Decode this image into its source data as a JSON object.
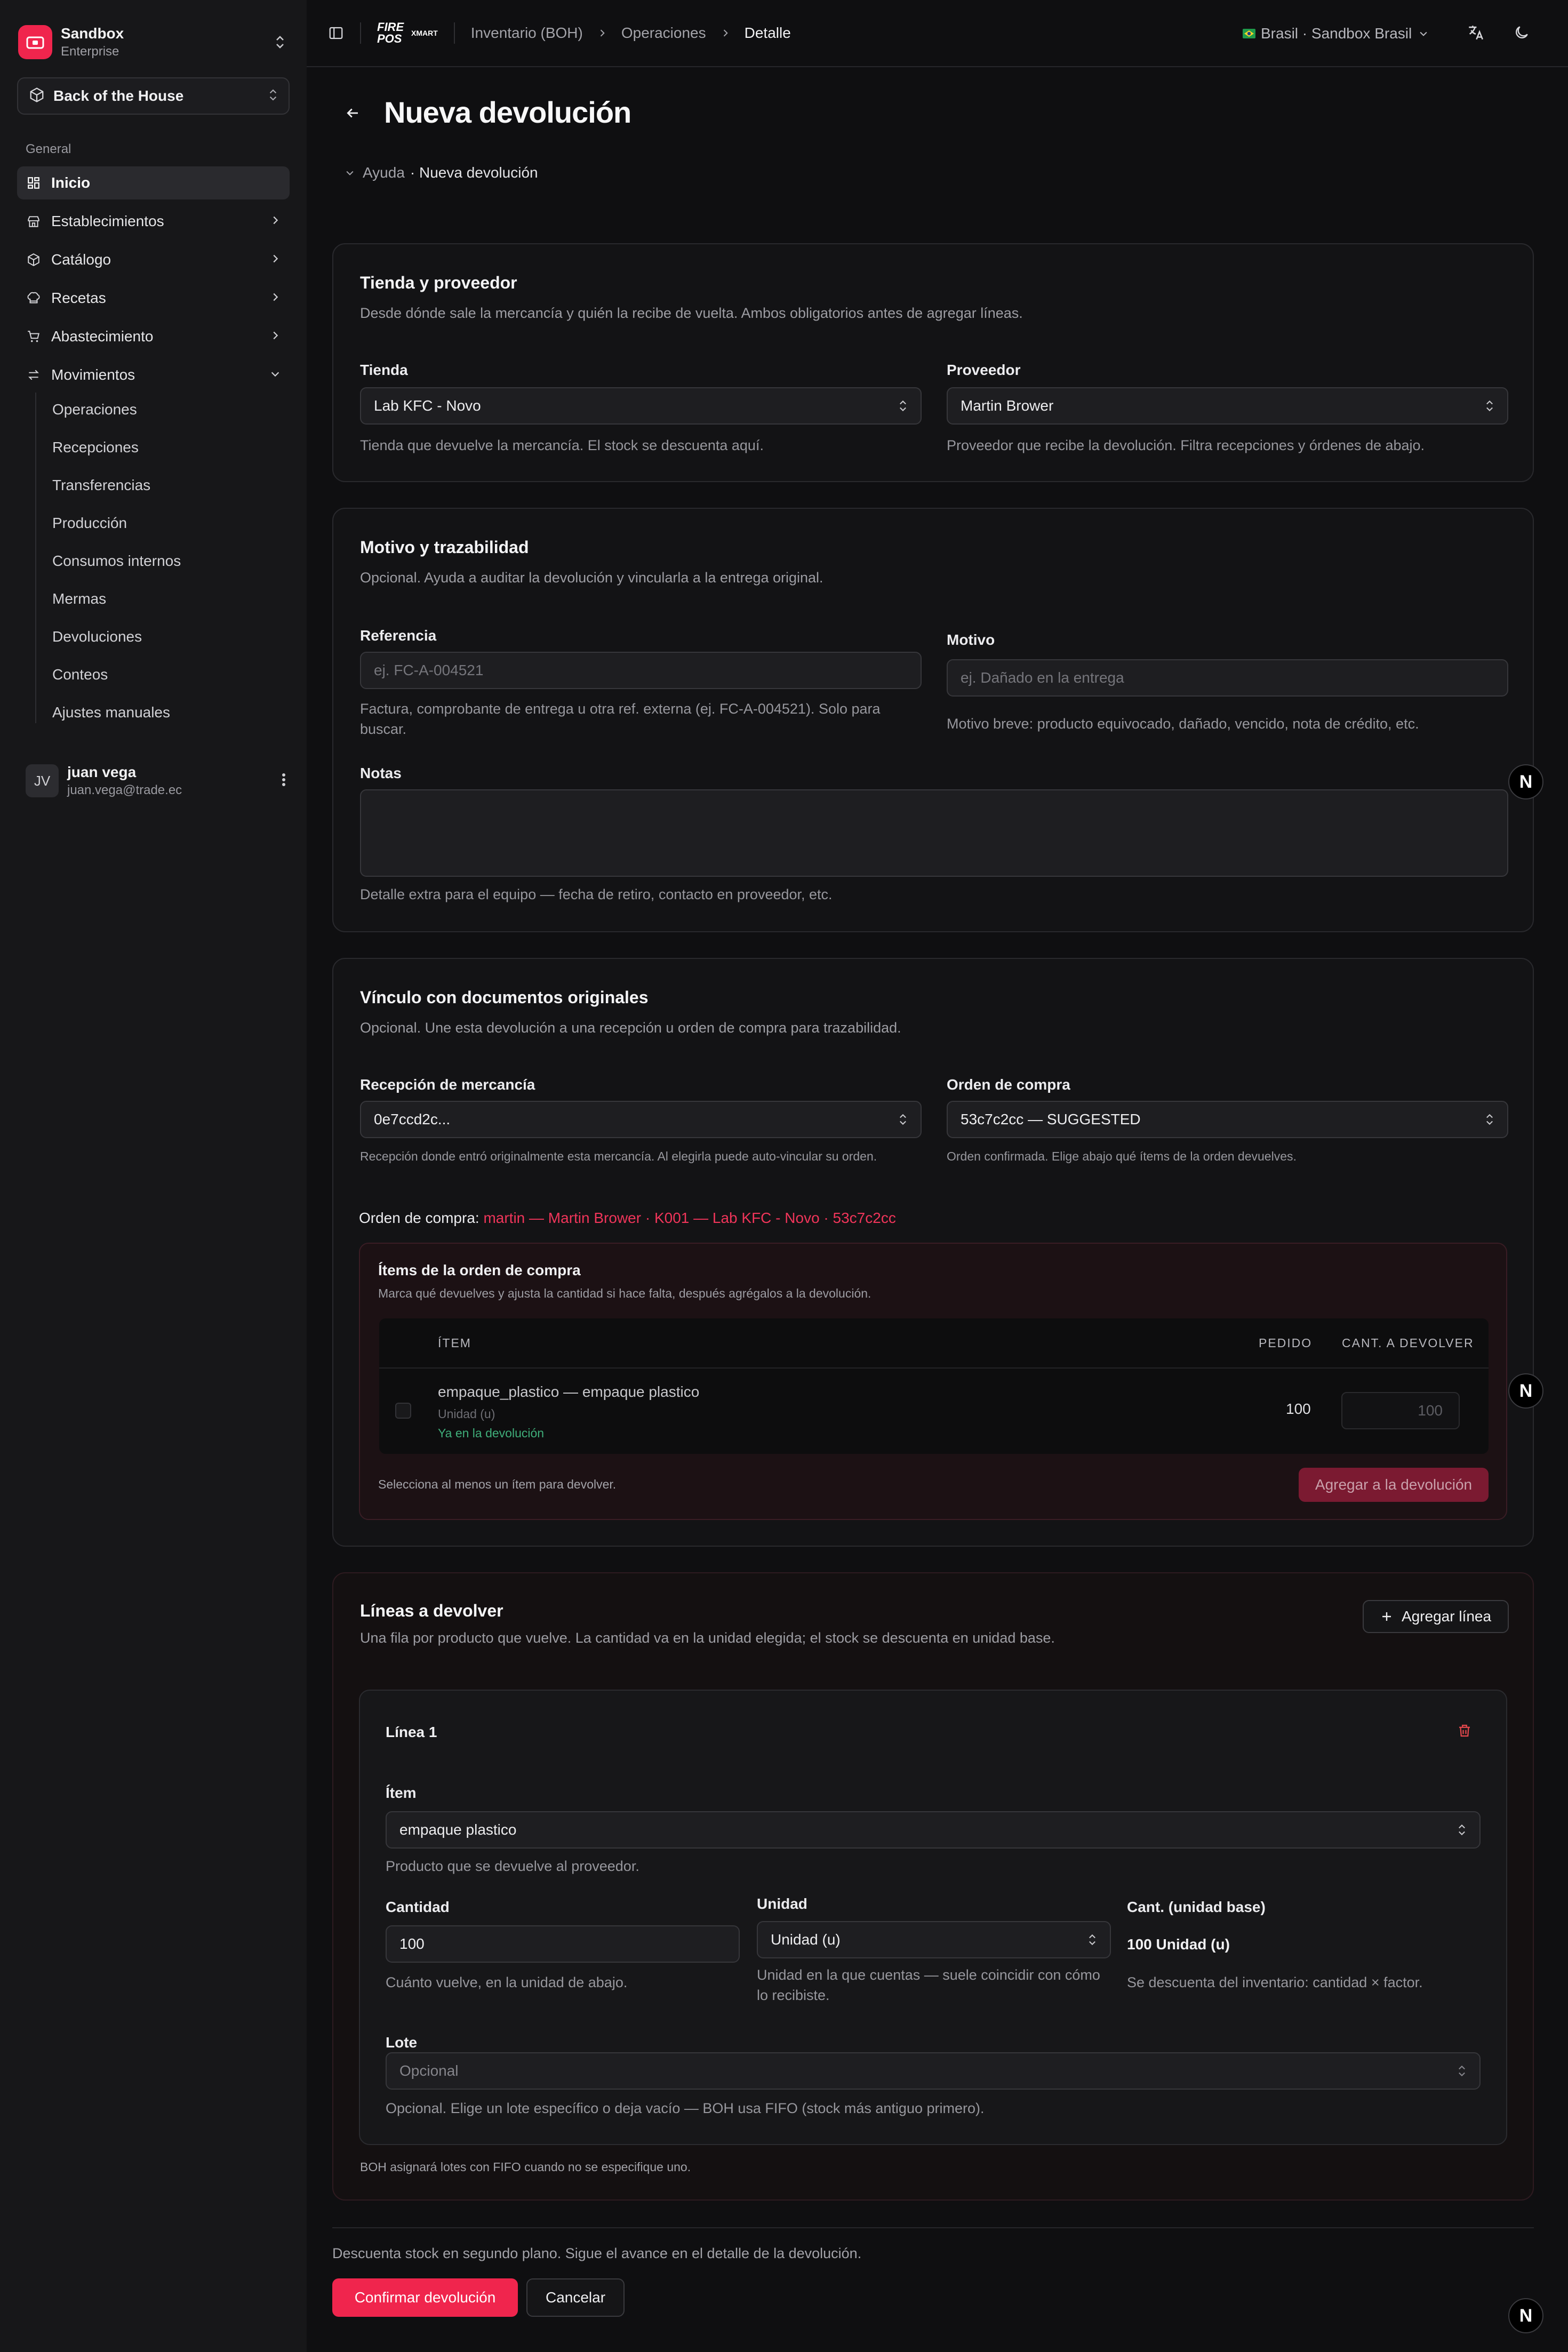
{
  "colors": {
    "accent": "#f0254d",
    "pink_text": "#f0355a",
    "green": "#3fae7a",
    "background": "#0f0f11",
    "sidebar": "#171719"
  },
  "sidebar": {
    "org_name": "Sandbox",
    "org_plan": "Enterprise",
    "module": "Back of the House",
    "section_label": "General",
    "items": [
      {
        "label": "Inicio",
        "icon": "dashboard-icon"
      },
      {
        "label": "Establecimientos",
        "icon": "store-icon"
      },
      {
        "label": "Catálogo",
        "icon": "package-icon"
      },
      {
        "label": "Recetas",
        "icon": "chef-hat-icon"
      },
      {
        "label": "Abastecimiento",
        "icon": "cart-icon"
      },
      {
        "label": "Movimientos",
        "icon": "arrows-swap-icon"
      }
    ],
    "sub_items": [
      "Operaciones",
      "Recepciones",
      "Transferencias",
      "Producción",
      "Consumos internos",
      "Mermas",
      "Devoluciones",
      "Conteos",
      "Ajustes manuales"
    ],
    "user": {
      "initials": "JV",
      "name": "juan vega",
      "email": "juan.vega@trade.ec"
    }
  },
  "topbar": {
    "logo_text": "FIRE POS",
    "logo_sub": "XMART",
    "breadcrumb": [
      "Inventario (BOH)",
      "Operaciones",
      "Detalle"
    ],
    "region": "Brasil · Sandbox Brasil"
  },
  "page": {
    "title": "Nueva devolución",
    "help_toggle": "Ayuda",
    "help_title": "· Nueva devolución"
  },
  "store_supplier": {
    "title": "Tienda y proveedor",
    "desc": "Desde dónde sale la mercancía y quién la recibe de vuelta. Ambos obligatorios antes de agregar líneas.",
    "store_label": "Tienda",
    "store_value": "Lab KFC - Novo",
    "store_help": "Tienda que devuelve la mercancía. El stock se descuenta aquí.",
    "supplier_label": "Proveedor",
    "supplier_value": "Martin Brower",
    "supplier_help": "Proveedor que recibe la devolución. Filtra recepciones y órdenes de abajo."
  },
  "reason": {
    "title": "Motivo y trazabilidad",
    "desc": "Opcional. Ayuda a auditar la devolución y vincularla a la entrega original.",
    "ref_label": "Referencia",
    "ref_placeholder": "ej. FC-A-004521",
    "ref_help": "Factura, comprobante de entrega u otra ref. externa (ej. FC-A-004521). Solo para buscar.",
    "reason_label": "Motivo",
    "reason_placeholder": "ej. Dañado en la entrega",
    "reason_help": "Motivo breve: producto equivocado, dañado, vencido, nota de crédito, etc.",
    "notes_label": "Notas",
    "notes_help": "Detalle extra para el equipo — fecha de retiro, contacto en proveedor, etc."
  },
  "link": {
    "title": "Vínculo con documentos originales",
    "desc": "Opcional. Une esta devolución a una recepción u orden de compra para trazabilidad.",
    "reception_label": "Recepción de mercancía",
    "reception_value": "0e7ccd2c...",
    "reception_help": "Recepción donde entró originalmente esta mercancía. Al elegirla puede auto-vincular su orden.",
    "po_label": "Orden de compra",
    "po_value": "53c7c2cc — SUGGESTED",
    "po_help": "Orden confirmada. Elige abajo qué ítems de la orden devuelves.",
    "po_line_prefix": "Orden de compra:",
    "po_line_value": "martin — Martin Brower · K001 — Lab KFC - Novo · 53c7c2cc",
    "items_title": "Ítems de la orden de compra",
    "items_desc": "Marca qué devuelves y ajusta la cantidad si hace falta, después agrégalos a la devolución.",
    "columns": [
      "ÍTEM",
      "PEDIDO",
      "CANT. A DEVOLVER"
    ],
    "rows": [
      {
        "name": "empaque_plastico — empaque plastico",
        "unit": "Unidad (u)",
        "status": "Ya en la devolución",
        "ordered": "100",
        "qty": "100"
      }
    ],
    "select_hint": "Selecciona al menos un ítem para devolver.",
    "add_button": "Agregar a la devolución"
  },
  "lines": {
    "title": "Líneas a devolver",
    "desc": "Una fila por producto que vuelve. La cantidad va en la unidad elegida; el stock se descuenta en unidad base.",
    "add_line": "Agregar línea",
    "line_title": "Línea 1",
    "item_label": "Ítem",
    "item_value": "empaque plastico",
    "item_help": "Producto que se devuelve al proveedor.",
    "qty_label": "Cantidad",
    "qty_value": "100",
    "qty_help": "Cuánto vuelve, en la unidad de abajo.",
    "unit_label": "Unidad",
    "unit_value": "Unidad (u)",
    "unit_help": "Unidad en la que cuentas — suele coincidir con cómo lo recibiste.",
    "base_label": "Cant. (unidad base)",
    "base_value": "100 Unidad (u)",
    "base_help": "Se descuenta del inventario: cantidad × factor.",
    "lot_label": "Lote",
    "lot_placeholder": "Opcional",
    "lot_help": "Opcional. Elige un lote específico o deja vacío — BOH usa FIFO (stock más antiguo primero).",
    "fifo_note": "BOH asignará lotes con FIFO cuando no se especifique uno."
  },
  "footer": {
    "note": "Descuenta stock en segundo plano. Sigue el avance en el detalle de la devolución.",
    "confirm": "Confirmar devolución",
    "cancel": "Cancelar"
  },
  "badge_letter": "N"
}
